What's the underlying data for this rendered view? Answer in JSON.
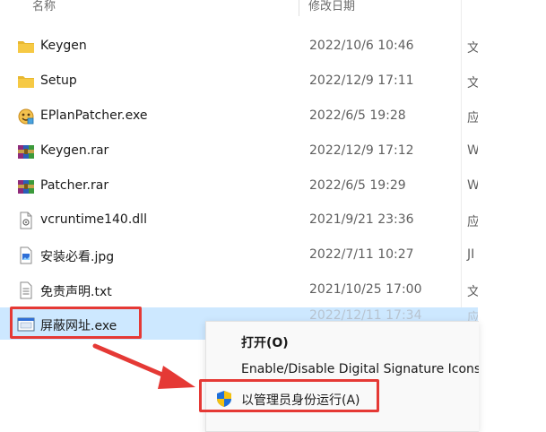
{
  "header": {
    "name_label": "名称",
    "date_label": "修改日期"
  },
  "files": [
    {
      "name": "Keygen",
      "date": "2022/10/6 10:46",
      "type": "文",
      "icon": "folder-icon"
    },
    {
      "name": "Setup",
      "date": "2022/12/9 17:11",
      "type": "文",
      "icon": "folder-icon"
    },
    {
      "name": "EPlanPatcher.exe",
      "date": "2022/6/5 19:28",
      "type": "应",
      "icon": "patcher-app-icon"
    },
    {
      "name": "Keygen.rar",
      "date": "2022/12/9 17:12",
      "type": "W",
      "icon": "winrar-archive-icon"
    },
    {
      "name": "Patcher.rar",
      "date": "2022/6/5 19:29",
      "type": "W",
      "icon": "winrar-archive-icon"
    },
    {
      "name": "vcruntime140.dll",
      "date": "2021/9/21 23:36",
      "type": "应",
      "icon": "dll-file-icon"
    },
    {
      "name": "安装必看.jpg",
      "date": "2022/7/11 10:27",
      "type": "JI",
      "icon": "image-file-icon"
    },
    {
      "name": "免责声明.txt",
      "date": "2021/10/25 17:00",
      "type": "文",
      "icon": "text-file-icon"
    },
    {
      "name": "屏蔽网址.exe",
      "date": "2022/12/11 17:34",
      "type": "应",
      "icon": "exe-app-icon",
      "selected": true
    }
  ],
  "context_menu": {
    "open": "打开(O)",
    "signature": "Enable/Disable Digital Signature Icons",
    "run_as_admin": "以管理员身份运行(A)"
  },
  "colors": {
    "selection": "#cde8ff",
    "highlight": "#e53935",
    "folder": "#f4c542"
  }
}
